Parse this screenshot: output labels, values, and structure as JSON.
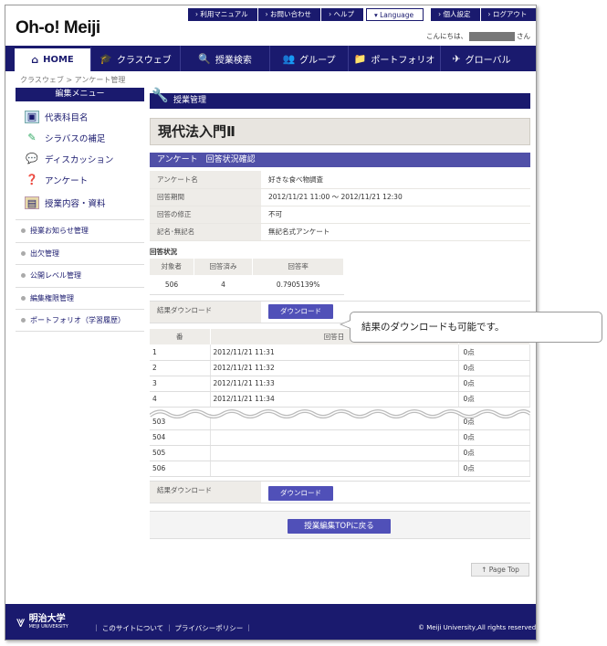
{
  "header": {
    "logo": "Oh-o! Meiji",
    "links": [
      "› 利用マニュアル",
      "› お問い合わせ",
      "› ヘルプ",
      "▾ Language",
      "› 個人設定",
      "› ログアウト"
    ],
    "greeting_prefix": "こんにちは、",
    "greeting_suffix": "さん"
  },
  "nav": {
    "items": [
      {
        "label": "HOME",
        "icon": "home-icon"
      },
      {
        "label": "クラスウェブ",
        "icon": "graduation-cap-icon"
      },
      {
        "label": "授業検索",
        "icon": "search-icon"
      },
      {
        "label": "グループ",
        "icon": "group-icon"
      },
      {
        "label": "ポートフォリオ",
        "icon": "folder-icon"
      },
      {
        "label": "グローバル",
        "icon": "airplane-icon"
      }
    ]
  },
  "breadcrumb": {
    "item1": "クラスウェブ",
    "sep": " > ",
    "item2": "アンケート管理"
  },
  "sidebar": {
    "title": "編集メニュー",
    "items": [
      {
        "label": "代表科目名",
        "icon": "monitor-icon"
      },
      {
        "label": "シラバスの補足",
        "icon": "pencil-icon"
      },
      {
        "label": "ディスカッション",
        "icon": "discussion-icon"
      },
      {
        "label": "アンケート",
        "icon": "survey-icon"
      },
      {
        "label": "授業内容・資料",
        "icon": "materials-icon"
      }
    ],
    "subitems": [
      "授業お知らせ管理",
      "出欠管理",
      "公開レベル管理",
      "編集権限管理",
      "ポートフォリオ（学習履歴）"
    ]
  },
  "main": {
    "section_title": "授業管理",
    "course_title": "現代法入門Ⅱ",
    "sub_title": "アンケート　回答状況確認",
    "info": [
      {
        "key": "アンケート名",
        "value": "好きな食べ物調査"
      },
      {
        "key": "回答期間",
        "value": "2012/11/21  11:00  ～  2012/11/21 12:30"
      },
      {
        "key": "回答の修正",
        "value": "不可"
      },
      {
        "key": "記名･無記名",
        "value": "無記名式アンケート"
      }
    ],
    "status_label": "回答状況",
    "status_headers": [
      "対象者",
      "回答済み",
      "回答率"
    ],
    "status_values": [
      "506",
      "4",
      "0.7905139%"
    ],
    "download_label": "結果ダウンロード",
    "download_button": "ダウンロード",
    "results_headers": [
      "番",
      "回答日",
      ""
    ],
    "results_top": [
      {
        "no": "1",
        "date": "2012/11/21 11:31",
        "score": "0点"
      },
      {
        "no": "2",
        "date": "2012/11/21 11:32",
        "score": "0点"
      },
      {
        "no": "3",
        "date": "2012/11/21 11:33",
        "score": "0点"
      },
      {
        "no": "4",
        "date": "2012/11/21 11:34",
        "score": "0点"
      }
    ],
    "results_bottom": [
      {
        "no": "503",
        "date": "",
        "score": "0点"
      },
      {
        "no": "504",
        "date": "",
        "score": "0点"
      },
      {
        "no": "505",
        "date": "",
        "score": "0点"
      },
      {
        "no": "506",
        "date": "",
        "score": "0点"
      }
    ],
    "back_button": "授業編集TOPに戻る"
  },
  "page_top": "Page Top",
  "footer": {
    "logo_name": "明治大学",
    "logo_en": "MEIJI UNIVERSITY",
    "links": "｜ このサイトについて ｜ プライバシーポリシー ｜",
    "copyright": "© Meiji University,All rights reserved."
  },
  "callout": {
    "text": "結果のダウンロードも可能です。"
  },
  "colors": {
    "brand": "#1a1a6e",
    "accent": "#5050b8"
  }
}
